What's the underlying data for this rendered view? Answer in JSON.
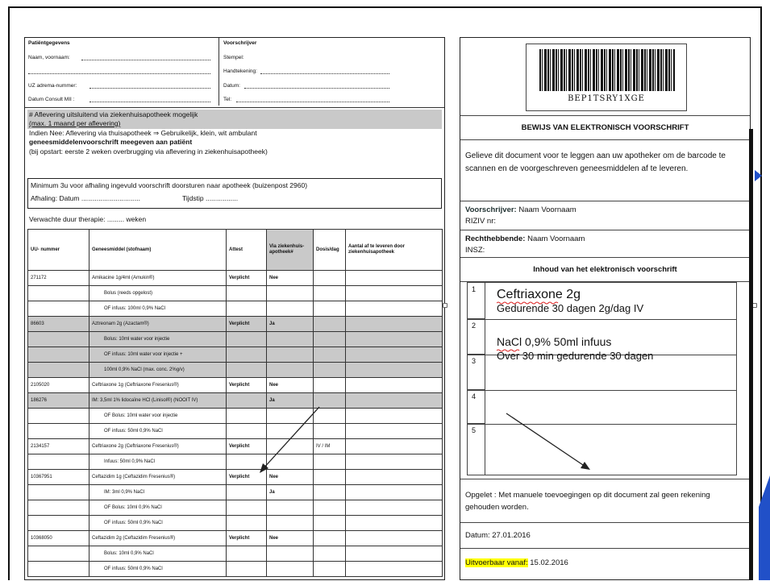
{
  "left_form": {
    "patient_header": "Patiëntgegevens",
    "prescriber_header": "Voorschrijver",
    "name_label": "Naam, voornaam:",
    "stamp_label": "Stempel:",
    "signature_label": "Handtekening:",
    "uz_label": "UZ adrema-nummer:",
    "date_label": "Datum:",
    "consult_label": "Datum Consult MII :",
    "tel_label": "Tel:",
    "delivery_line1": "# Aflevering uitsluitend via ziekenhuisapotheek mogelijk",
    "delivery_line2": "(max. 1 maand per aflevering)",
    "delivery_line3": "Indien Nee: Aflevering via thuisapotheek ⇒ Gebruikelijk, klein, wit ambulant",
    "delivery_line4": "geneesmiddelenvoorschrift meegeven aan patiënt",
    "delivery_line5": "(bij opstart: eerste 2 weken overbrugging via aflevering in ziekenhuisapotheek)",
    "minimum_line1": "Minimum 3u voor afhaling ingevuld voorschrift doorsturen naar apotheek (buizenpost 2960)",
    "minimum_line2_label": "Afhaling: Datum ...............................",
    "minimum_line2_time": "Tijdstip .................",
    "duration_line": "Verwachte duur therapie: ......... weken",
    "table_headers": [
      "UU- nummer",
      "Geneesmiddel (stofnaam)",
      "Attest",
      "Via ziekenhuis-apotheek#",
      "Dosis/dag",
      "Aantal af te leveren door ziekenhuisapotheek"
    ],
    "rows": [
      {
        "nr": "271172",
        "med": "Amikacine 1g/4ml (Amukin®)",
        "attest": "Verplicht",
        "via": "Nee",
        "dose": "",
        "grey": false
      },
      {
        "nr": "",
        "med": "Bolus (reeds opgelost)",
        "attest": "",
        "via": "",
        "dose": "",
        "grey": false
      },
      {
        "nr": "",
        "med": "OF infuus: 100ml 0,9% NaCl",
        "attest": "",
        "via": "",
        "dose": "",
        "grey": false
      },
      {
        "nr": "86603",
        "med": "Aztreonam 2g (Azactam®)",
        "attest": "Verplicht",
        "via": "Ja",
        "dose": "",
        "grey": true
      },
      {
        "nr": "",
        "med": "Bolus: 10ml water voor injectie",
        "attest": "",
        "via": "",
        "dose": "",
        "grey": true
      },
      {
        "nr": "",
        "med": "OF infuus: 10ml water voor injectie +",
        "attest": "",
        "via": "",
        "dose": "",
        "grey": true
      },
      {
        "nr": "",
        "med": "100ml 0,9% NaCl (max. conc. 2%g/v)",
        "attest": "",
        "via": "",
        "dose": "",
        "grey": true
      },
      {
        "nr": "2105020",
        "med": "Ceftriaxone 1g (Ceftriaxone Fresenius®)",
        "attest": "Verplicht",
        "via": "Nee",
        "dose": "",
        "grey": false
      },
      {
        "nr": "186276",
        "med": "IM: 3,5ml 1% lidocaïne HCl (Linisol®) (NOOIT IV)",
        "attest": "",
        "via": "Ja",
        "dose": "",
        "grey": true
      },
      {
        "nr": "",
        "med": "OF Bolus: 10ml water voor injectie",
        "attest": "",
        "via": "",
        "dose": "",
        "grey": false
      },
      {
        "nr": "",
        "med": "OF infuus: 50ml 0,9% NaCl",
        "attest": "",
        "via": "",
        "dose": "",
        "grey": false
      },
      {
        "nr": "2134157",
        "med": "Ceftriaxone 2g (Ceftriaxone Fresenius®)",
        "attest": "Verplicht",
        "via": "",
        "dose": "IV / IM",
        "grey": false
      },
      {
        "nr": "",
        "med": "Infuus: 50ml 0,9% NaCl",
        "attest": "",
        "via": "",
        "dose": "",
        "grey": false
      },
      {
        "nr": "10367951",
        "med": "Ceftazidim 1g (Ceftazidim Fresenius®)",
        "attest": "Verplicht",
        "via": "Nee",
        "dose": "",
        "grey": false
      },
      {
        "nr": "",
        "med": "IM: 3ml 0,9% NaCl",
        "attest": "",
        "via": "Ja",
        "dose": "",
        "grey": false
      },
      {
        "nr": "",
        "med": "OF Bolus: 10ml 0,9% NaCl",
        "attest": "",
        "via": "",
        "dose": "",
        "grey": false
      },
      {
        "nr": "",
        "med": "OF infuus: 50ml 0,9% NaCl",
        "attest": "",
        "via": "",
        "dose": "",
        "grey": false
      },
      {
        "nr": "10368050",
        "med": "Ceftazidim 2g (Ceftazidim Fresenius®)",
        "attest": "Verplicht",
        "via": "Nee",
        "dose": "",
        "grey": false
      },
      {
        "nr": "",
        "med": "Bolus: 10ml 0,9% NaCl",
        "attest": "",
        "via": "",
        "dose": "",
        "grey": false
      },
      {
        "nr": "",
        "med": "OF infuus: 50ml 0,9% NaCl",
        "attest": "",
        "via": "",
        "dose": "",
        "grey": false
      }
    ]
  },
  "right_form": {
    "barcode_text": "BEP1TSRY1XGE",
    "title": "BEWIJS VAN ELEKTRONISCH VOORSCHRIFT",
    "instructions": "Gelieve dit document voor te leggen aan uw apotheker om de barcode te scannen en de voorgeschreven geneesmiddelen af te leveren.",
    "prescriber_label": "Voorschrijver:",
    "prescriber_value": "Naam Voornaam",
    "riziv_label": "RIZIV nr:",
    "beneficiary_label": "Rechthebbende:",
    "beneficiary_value": "Naam Voornaam",
    "insz_label": "INSZ:",
    "content_title": "Inhoud van het elektronisch voorschrift",
    "line_numbers": [
      "1",
      "2",
      "3",
      "4",
      "5"
    ],
    "handwritten": {
      "drug1": "Ceftriaxone 2g",
      "drug1_dose": "Gedurende 30 dagen 2g/dag IV",
      "drug2": "NaCl 0,9% 50ml infuus",
      "drug2_dose": "Over 30 min gedurende 30 dagen"
    },
    "warning": "Opgelet : Met manuele toevoegingen op dit document zal geen rekening gehouden worden.",
    "date_text": "Datum: 27.01.2016",
    "executable_label": "Uitvoerbaar vanaf:",
    "executable_date": "15.02.2016"
  },
  "colors": {
    "grey_fill": "#c9c9c9",
    "highlight": "#ffff00",
    "accent_blue": "#2150c8"
  }
}
